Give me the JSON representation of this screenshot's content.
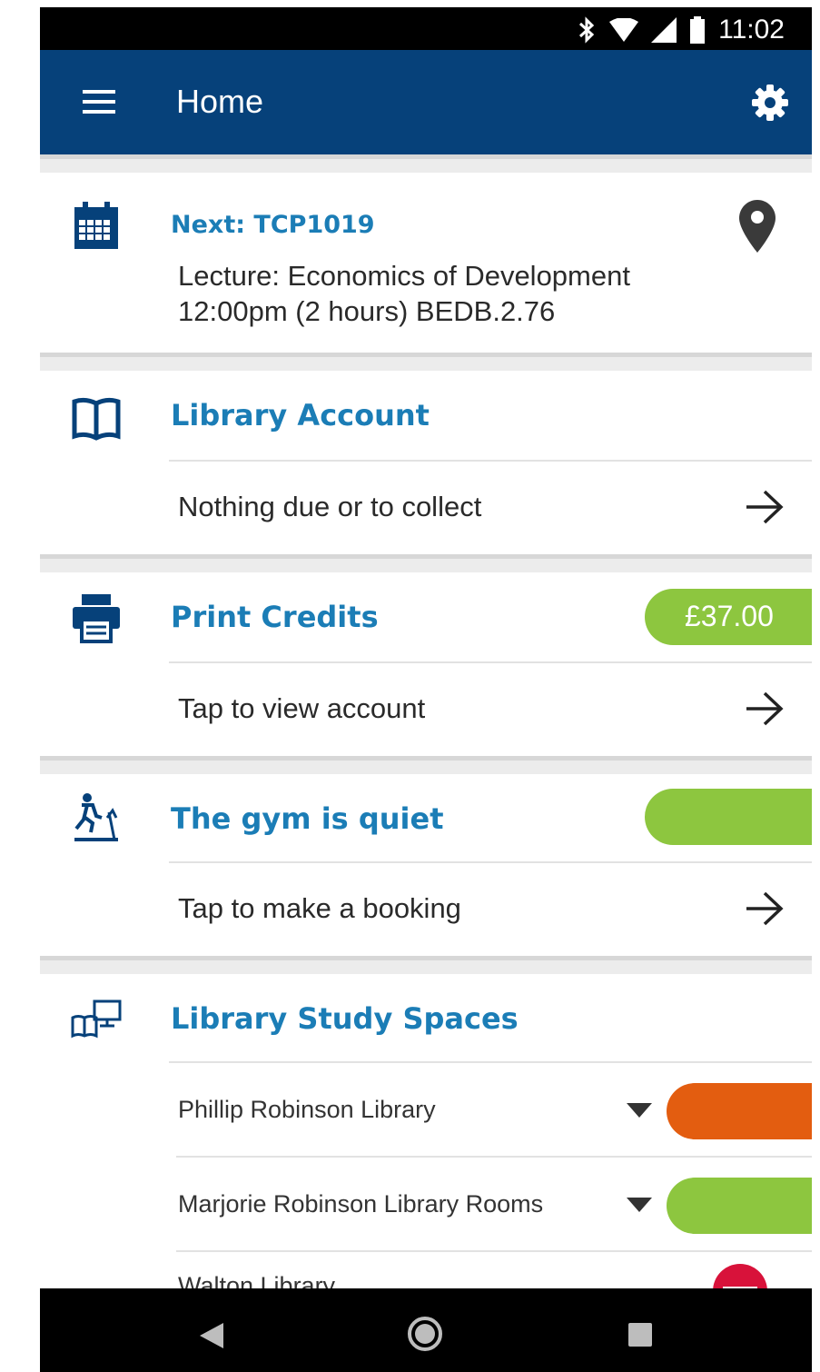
{
  "status_bar": {
    "time": "11:02"
  },
  "app_bar": {
    "title": "Home"
  },
  "next_event": {
    "title": "Next: TCP1019",
    "line1": "Lecture: Economics of Development",
    "line2": "12:00pm (2 hours) BEDB.2.76"
  },
  "library_account": {
    "title": "Library Account",
    "status": "Nothing due or to collect"
  },
  "print_credits": {
    "title": "Print Credits",
    "balance": "£37.00",
    "action": "Tap to view account"
  },
  "gym": {
    "title": "The gym is quiet",
    "action": "Tap to make a booking"
  },
  "study_spaces": {
    "title": "Library Study Spaces",
    "items": [
      {
        "name": "Phillip Robinson Library",
        "status_color": "#e35d10"
      },
      {
        "name": "Marjorie Robinson Library Rooms",
        "status_color": "#8dc63f"
      },
      {
        "name": "Walton Library",
        "status_color": "#d8123a"
      }
    ]
  },
  "colors": {
    "primary": "#06417a",
    "accent_text": "#1b7db6",
    "pill_green": "#8dc63f",
    "pill_orange": "#e35d10"
  }
}
